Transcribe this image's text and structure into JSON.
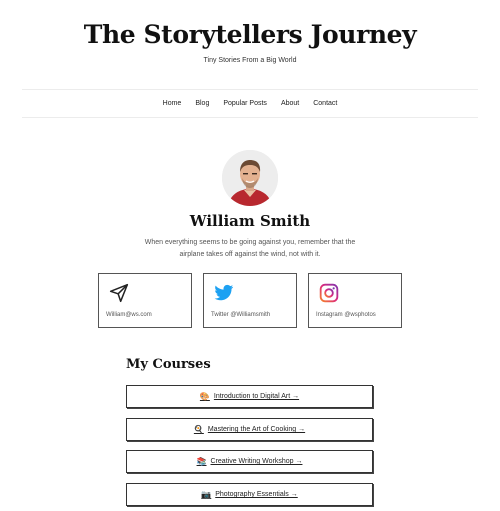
{
  "header": {
    "site_title": "The Storytellers Journey",
    "tagline": "Tiny Stories From a Big World"
  },
  "nav": {
    "items": [
      {
        "label": "Home"
      },
      {
        "label": "Blog"
      },
      {
        "label": "Popular Posts"
      },
      {
        "label": "About"
      },
      {
        "label": "Contact"
      }
    ]
  },
  "author": {
    "name": "William Smith",
    "bio": "When everything seems to be going against you, remember that the airplane takes off against the wind, not with it.",
    "avatar_icon": "avatar-photo"
  },
  "contacts": [
    {
      "icon": "paper-plane-icon",
      "label": "William@ws.com",
      "color": "#222222"
    },
    {
      "icon": "twitter-icon",
      "label": "Twitter @Williamsmith",
      "color": "#1DA1F2"
    },
    {
      "icon": "instagram-icon",
      "label": "Instagram @wsphotos",
      "color": "#C13584"
    }
  ],
  "courses": {
    "title": "My Courses",
    "items": [
      {
        "icon": "palette-icon",
        "label": "Introduction to Digital Art →"
      },
      {
        "icon": "frying-pan-icon",
        "label": "Mastering the Art of Cooking →"
      },
      {
        "icon": "books-icon",
        "label": "Creative Writing Workshop →"
      },
      {
        "icon": "camera-icon",
        "label": "Photography Essentials →"
      }
    ]
  }
}
